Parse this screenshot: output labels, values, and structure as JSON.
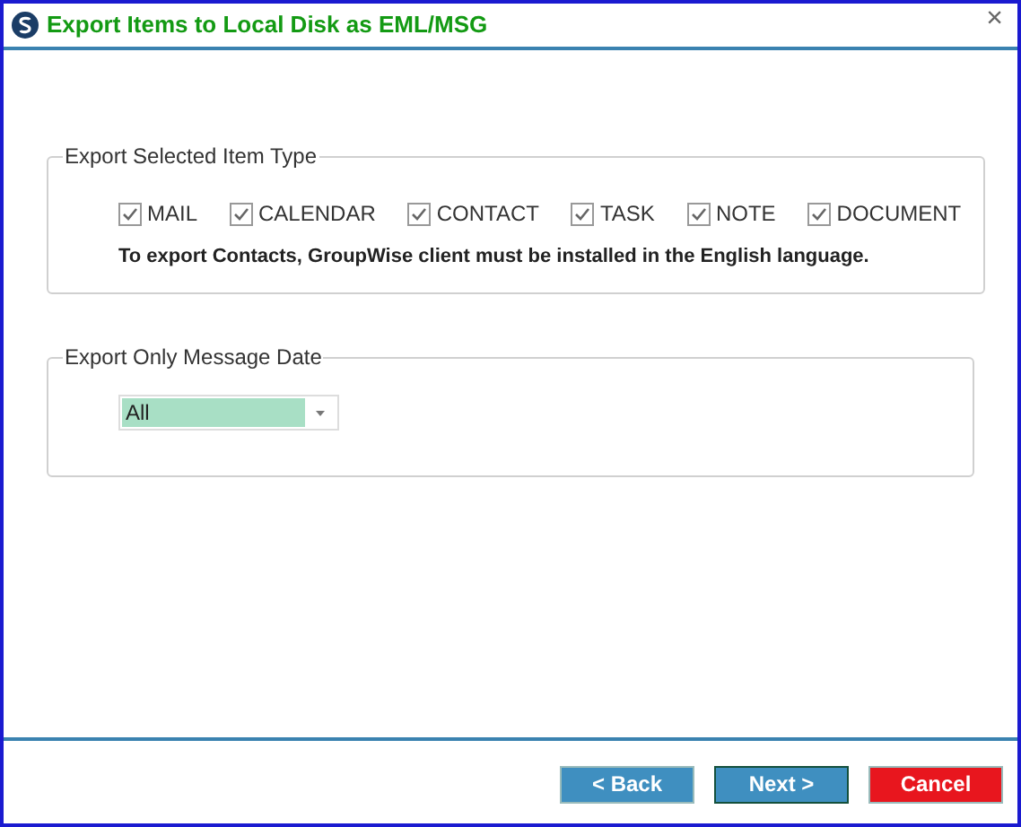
{
  "window": {
    "title": "Export Items to Local Disk as EML/MSG",
    "close": "×"
  },
  "item_types": {
    "legend": "Export Selected Item Type",
    "options": [
      {
        "label": "MAIL",
        "checked": true
      },
      {
        "label": "CALENDAR",
        "checked": true
      },
      {
        "label": "CONTACT",
        "checked": true
      },
      {
        "label": "TASK",
        "checked": true
      },
      {
        "label": "NOTE",
        "checked": true
      },
      {
        "label": "DOCUMENT",
        "checked": true
      }
    ],
    "note": "To export Contacts, GroupWise client must be installed in the English language."
  },
  "date_filter": {
    "legend": "Export Only Message Date",
    "value": "All"
  },
  "buttons": [
    {
      "label": "< Back",
      "kind": "primary",
      "focused": false
    },
    {
      "label": "Next >",
      "kind": "primary",
      "focused": true
    },
    {
      "label": "Cancel",
      "kind": "danger",
      "focused": false
    }
  ]
}
